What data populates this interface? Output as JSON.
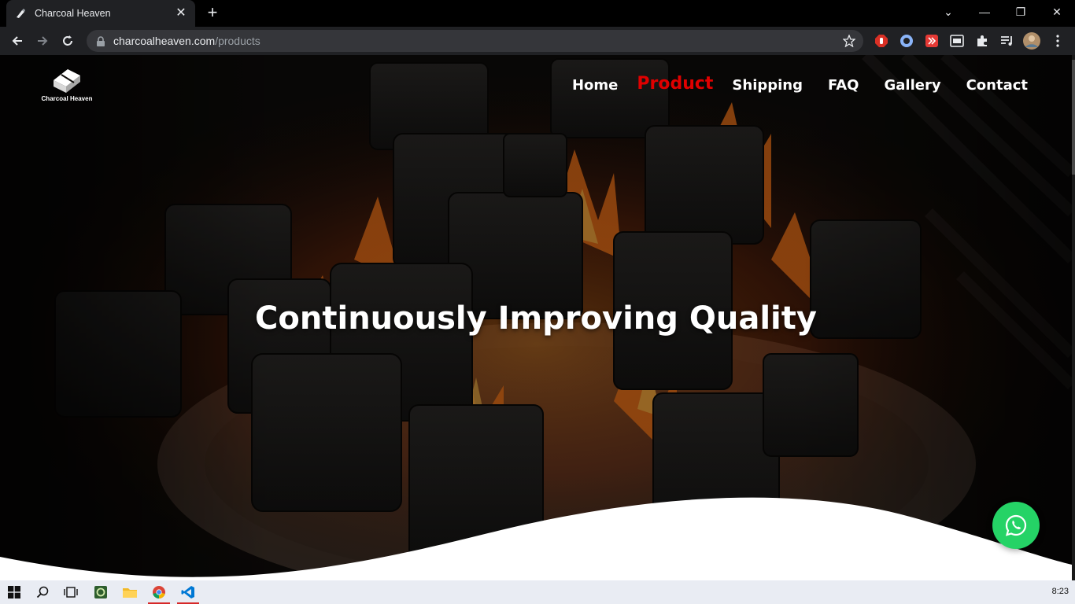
{
  "browser": {
    "tab_title": "Charcoal Heaven",
    "tab_close": "✕",
    "new_tab": "+",
    "url_host": "charcoalheaven.com",
    "url_path": "/products",
    "window_controls": {
      "dropdown": "⌄",
      "minimize": "—",
      "restore": "❐",
      "close": "✕"
    },
    "extensions": [
      "adblock-icon",
      "extension-circle-icon",
      "extension-red-icon",
      "media-icon",
      "puzzle-icon",
      "reading-list-icon",
      "profile-avatar",
      "menu-dots-icon"
    ]
  },
  "site": {
    "brand_name": "Charcoal Heaven",
    "nav": [
      {
        "label": "Home",
        "active": false
      },
      {
        "label": "Product",
        "active": true
      },
      {
        "label": "Shipping",
        "active": false
      },
      {
        "label": "FAQ",
        "active": false
      },
      {
        "label": "Gallery",
        "active": false
      },
      {
        "label": "Contact",
        "active": false
      }
    ],
    "headline": "Continuously Improving Quality",
    "whatsapp_icon": "whatsapp-icon",
    "colors": {
      "active_nav": "#e00000",
      "whatsapp": "#25d366",
      "flame": "#ff7a1a"
    }
  },
  "taskbar": {
    "items": [
      "windows-start-icon",
      "search-icon",
      "task-view-icon",
      "app-icon",
      "file-explorer-icon",
      "chrome-icon",
      "vscode-icon"
    ],
    "clock": "8:23"
  }
}
